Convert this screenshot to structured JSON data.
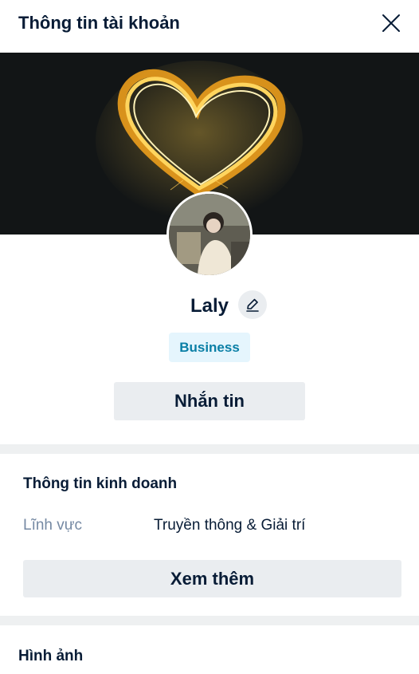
{
  "header": {
    "title": "Thông tin tài khoản",
    "close_icon": "close-icon"
  },
  "profile": {
    "name": "Laly",
    "edit_icon": "pencil-icon",
    "badge": "Business",
    "message_button": "Nhắn tin"
  },
  "business_info": {
    "title": "Thông tin kinh doanh",
    "field_label": "Lĩnh vực",
    "field_value": "Truyền thông & Giải trí",
    "more_button": "Xem thêm"
  },
  "images_section": {
    "title": "Hình ảnh"
  },
  "colors": {
    "text": "#081c36",
    "muted": "#7589a3",
    "button_bg": "#eaedf0",
    "badge_bg": "#e5f5fd",
    "badge_text": "#0a7fa6",
    "divider": "#eef0f1",
    "cover_bg": "#121516"
  }
}
